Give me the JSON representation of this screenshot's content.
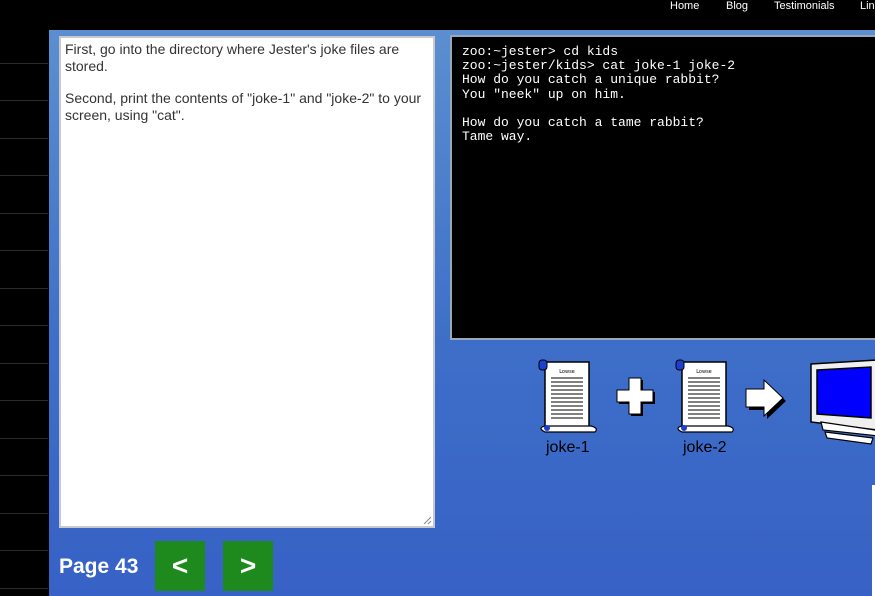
{
  "nav": {
    "items": [
      {
        "label": "Home"
      },
      {
        "label": "Blog"
      },
      {
        "label": "Testimonials"
      },
      {
        "label": "Lin"
      }
    ]
  },
  "lesson": {
    "paragraph_1": "First, go into the directory where Jester's joke files are stored.",
    "paragraph_2": "Second, print the contents of \"joke-1\" and \"joke-2\" to your screen, using \"cat\"."
  },
  "terminal": {
    "lines": [
      "zoo:~jester> cd kids",
      "zoo:~jester/kids> cat joke-1 joke-2",
      "How do you catch a unique rabbit?",
      "You \"neek\" up on him.",
      "",
      "How do you catch a tame rabbit?",
      "Tame way."
    ]
  },
  "diagram": {
    "file_1": "joke-1",
    "file_2": "joke-2",
    "scroll_header": "Lowse",
    "icons": [
      "scroll-icon",
      "plus-icon",
      "scroll-icon",
      "arrow-right-icon",
      "monitor-icon"
    ]
  },
  "pager": {
    "label": "Page 43",
    "prev_label": "<",
    "next_label": ">"
  },
  "colors": {
    "panel_top": "#5b8fd0",
    "panel_bottom": "#3761c6",
    "button_green": "#1e8a1e",
    "monitor_screen": "#0000ff"
  }
}
